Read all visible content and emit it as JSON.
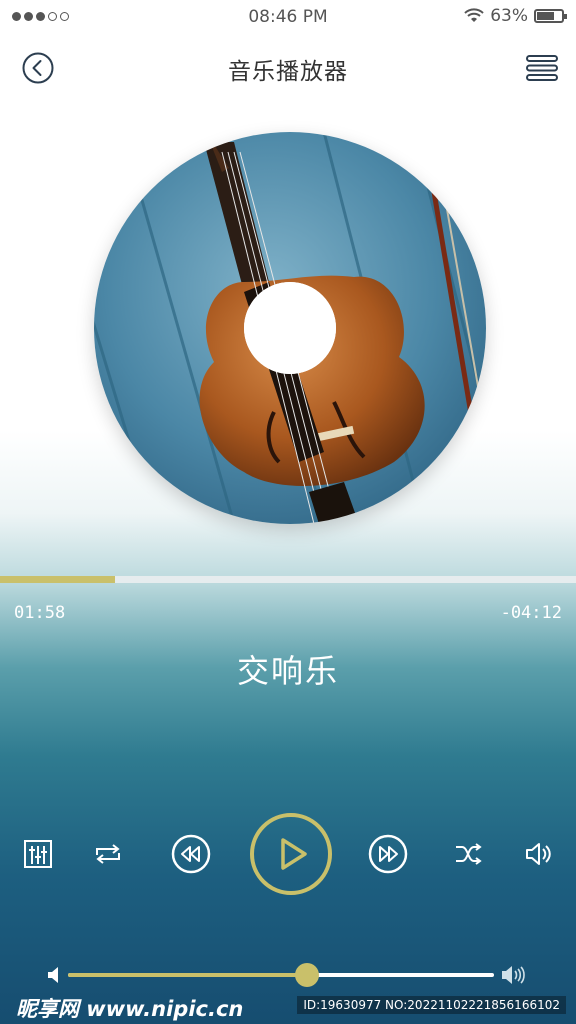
{
  "status_bar": {
    "time": "08:46 PM",
    "battery_percent": "63%",
    "signal_filled": 3,
    "signal_total": 5
  },
  "header": {
    "title": "音乐播放器",
    "back_icon": "back-chevron-icon",
    "menu_icon": "hamburger-menu-icon"
  },
  "album_art": {
    "description_icon": "violin-disc-art"
  },
  "playback": {
    "elapsed": "01:58",
    "remaining": "-04:12",
    "progress": 0.2
  },
  "track": {
    "title": "交响乐"
  },
  "controls": [
    {
      "name": "equalizer-icon"
    },
    {
      "name": "repeat-icon"
    },
    {
      "name": "rewind-icon"
    },
    {
      "name": "play-icon"
    },
    {
      "name": "fast-forward-icon"
    },
    {
      "name": "shuffle-icon"
    },
    {
      "name": "speaker-icon"
    }
  ],
  "volume": {
    "level": 0.56,
    "low_icon": "volume-low-icon",
    "high_icon": "volume-high-icon"
  },
  "colors": {
    "accent": "#c9c06a",
    "text_dark": "#333333",
    "control": "#ffffff"
  },
  "watermark": {
    "brand": "昵享网 www.nipic.cn",
    "id": "ID:19630977 NO:20221102221856166102"
  }
}
